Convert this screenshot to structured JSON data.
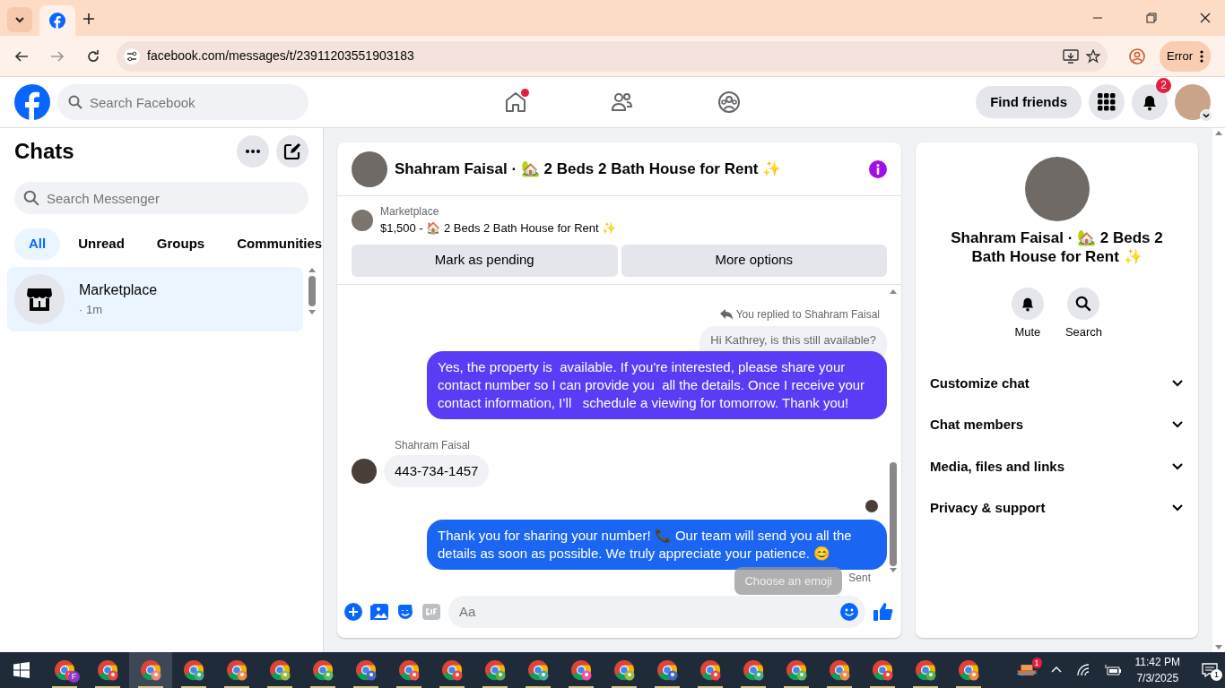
{
  "browser": {
    "url": "facebook.com/messages/t/23911203551903183",
    "profile_button": "Error"
  },
  "header": {
    "search_placeholder": "Search Facebook",
    "nav": [
      {
        "kind": "home",
        "dot": true
      },
      {
        "kind": "friends",
        "dot": false
      },
      {
        "kind": "groups",
        "dot": false
      }
    ],
    "find_friends": "Find friends",
    "notifications_count": "2"
  },
  "sidebar": {
    "title": "Chats",
    "search_placeholder": "Search Messenger",
    "filters": [
      {
        "label": "All",
        "selected": true
      },
      {
        "label": "Unread",
        "selected": false
      },
      {
        "label": "Groups",
        "selected": false
      },
      {
        "label": "Communities",
        "selected": false
      }
    ],
    "chats": [
      {
        "name": "Marketplace",
        "time": "· 1m",
        "selected": true
      }
    ]
  },
  "conversation": {
    "title": "Shahram Faisal · 🏡 2 Beds 2 Bath House for Rent ✨",
    "listing": {
      "label": "Marketplace",
      "text": "$1,500 - 🏠 2 Beds 2 Bath House for Rent ✨"
    },
    "actions": [
      "Mark as pending",
      "More options"
    ],
    "messages": [
      {
        "kind": "reply_note",
        "text": "You replied to Shahram Faisal"
      },
      {
        "kind": "quoted",
        "text": "Hi Kathrey, is this still available?"
      },
      {
        "kind": "outgoing",
        "color": "#5b3cf6",
        "text": "Yes, the property is  available. If you're interested, please share your contact number so I can provide you  all the details. Once I receive your contact information, I’ll   schedule a viewing for tomorrow. Thank you!"
      },
      {
        "kind": "sender",
        "text": "Shahram Faisal"
      },
      {
        "kind": "incoming",
        "text": "443-734-1457"
      },
      {
        "kind": "seen"
      },
      {
        "kind": "outgoing",
        "color": "#1a66f2",
        "text": "Thank you for sharing your number! 📞 Our team will send you all the details as soon as possible. We truly appreciate your patience. 😊"
      },
      {
        "kind": "status",
        "text": "Sent"
      }
    ],
    "tooltip": "Choose an emoji",
    "composer_placeholder": "Aa"
  },
  "details": {
    "title": "Shahram Faisal · 🏡 2 Beds 2 Bath House for Rent ✨",
    "actions": [
      "Mute",
      "Search"
    ],
    "sections": [
      "Customize chat",
      "Chat members",
      "Media, files and links",
      "Privacy & support"
    ]
  },
  "taskbar": {
    "apps": [
      {
        "selected": false,
        "badge": "F"
      },
      {
        "selected": false
      },
      {
        "selected": true
      },
      {
        "selected": false
      },
      {
        "selected": false
      },
      {
        "selected": false
      },
      {
        "selected": false
      },
      {
        "selected": false
      },
      {
        "selected": false
      },
      {
        "selected": false
      },
      {
        "selected": false
      },
      {
        "selected": false
      },
      {
        "selected": false
      },
      {
        "selected": false
      },
      {
        "selected": false
      },
      {
        "selected": false
      },
      {
        "selected": false
      },
      {
        "selected": false
      },
      {
        "selected": false
      },
      {
        "selected": false
      },
      {
        "selected": false
      },
      {
        "selected": false
      }
    ],
    "tray_badge": "1",
    "time": "11:42 PM",
    "date": "7/3/2025",
    "notification_count": "1"
  }
}
